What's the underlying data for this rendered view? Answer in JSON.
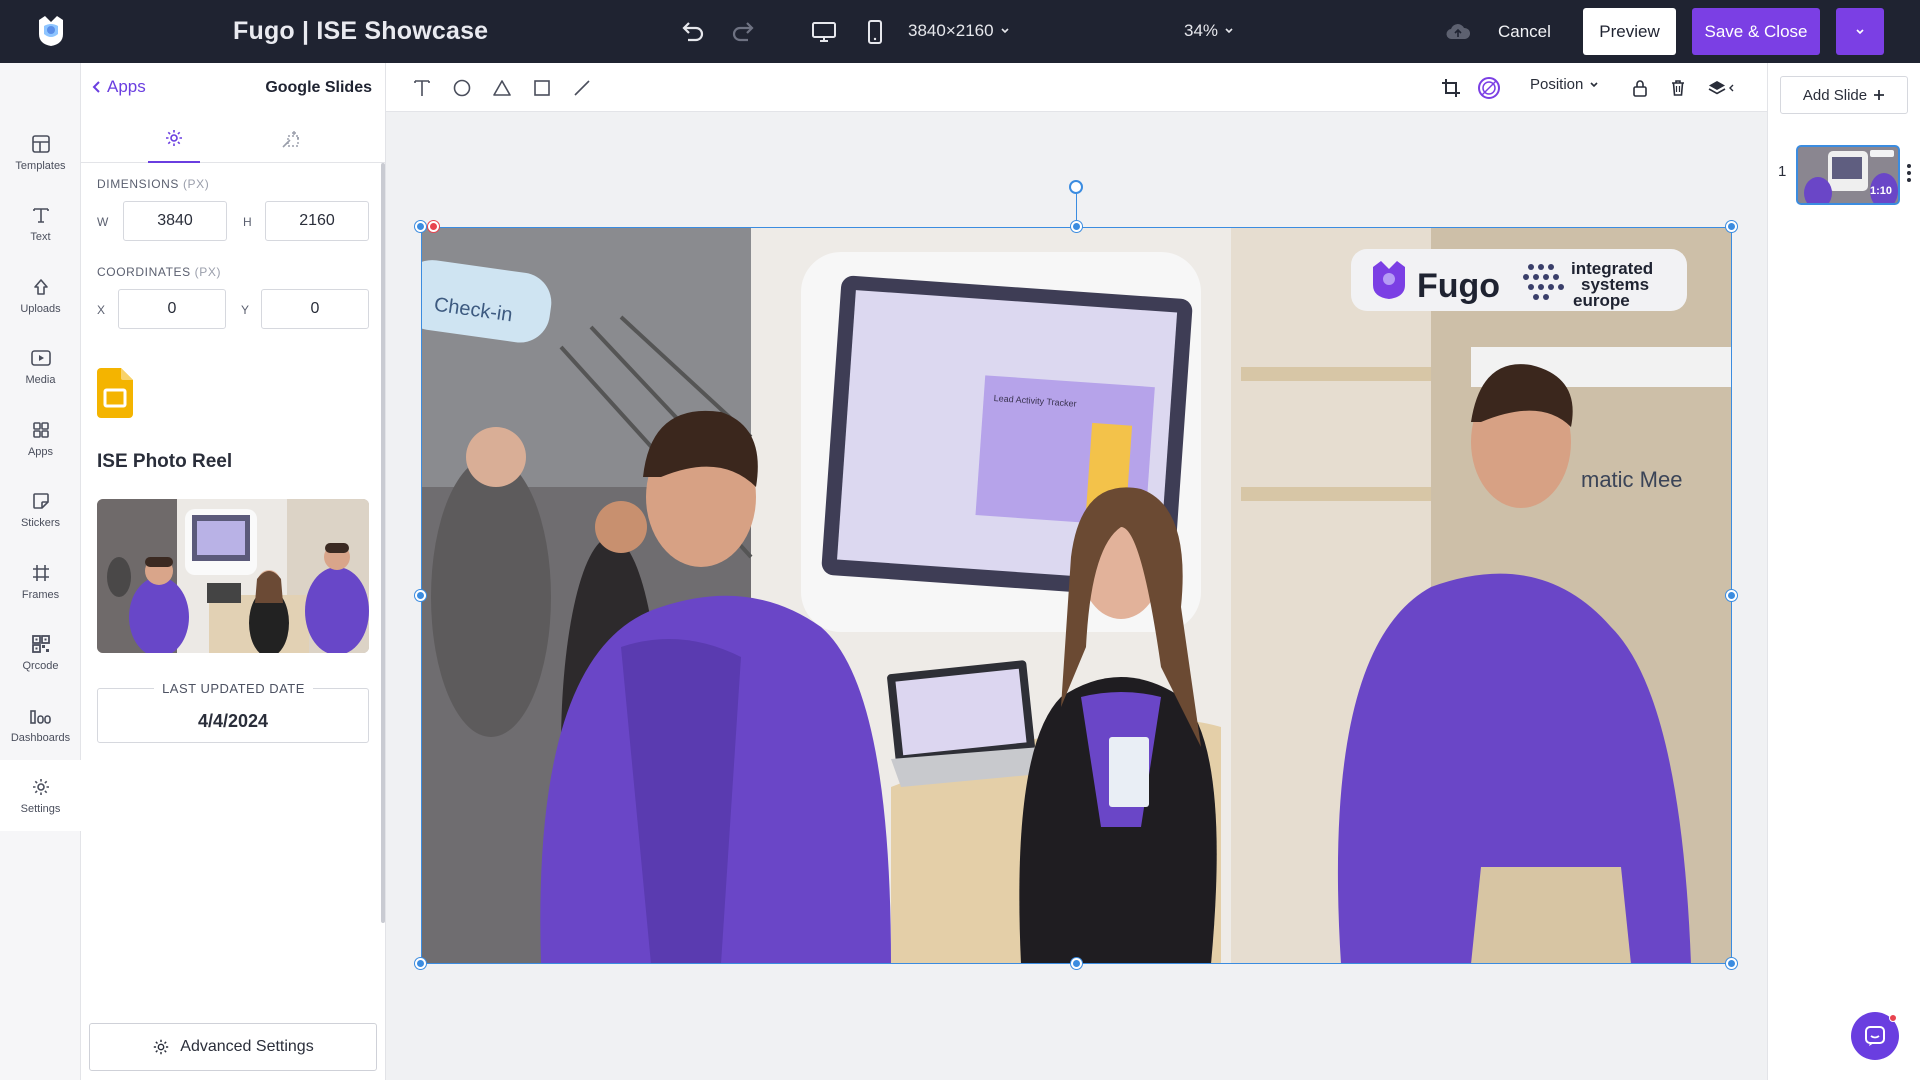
{
  "topbar": {
    "title": "Fugo | ISE Showcase",
    "resolution": "3840×2160",
    "zoom": "34%",
    "cancel_label": "Cancel",
    "preview_label": "Preview",
    "save_label": "Save & Close"
  },
  "rail": {
    "items": [
      {
        "label": "Templates",
        "icon": "templates-icon"
      },
      {
        "label": "Text",
        "icon": "text-icon"
      },
      {
        "label": "Uploads",
        "icon": "upload-icon"
      },
      {
        "label": "Media",
        "icon": "media-icon"
      },
      {
        "label": "Apps",
        "icon": "apps-icon"
      },
      {
        "label": "Stickers",
        "icon": "sticker-icon"
      },
      {
        "label": "Frames",
        "icon": "frames-icon"
      },
      {
        "label": "Qrcode",
        "icon": "qrcode-icon"
      },
      {
        "label": "Dashboards",
        "icon": "dashboards-icon"
      },
      {
        "label": "Settings",
        "icon": "gear-icon"
      }
    ]
  },
  "panel": {
    "back_label": "Apps",
    "title": "Google Slides",
    "dimensions_label": "DIMENSIONS",
    "coordinates_label": "COORDINATES",
    "unit_label": "(PX)",
    "w_label": "W",
    "h_label": "H",
    "x_label": "X",
    "y_label": "Y",
    "w_value": "3840",
    "h_value": "2160",
    "x_value": "0",
    "y_value": "0",
    "app_name": "ISE Photo Reel",
    "last_updated_label": "LAST UPDATED DATE",
    "last_updated_value": "4/4/2024",
    "advanced_label": "Advanced Settings"
  },
  "edtool": {
    "position_label": "Position"
  },
  "canvas": {
    "sign_left": "Check-in",
    "brand": "Fugo",
    "partner_line1": "integrated",
    "partner_line2": "systems",
    "partner_line3": "europe",
    "screen_text": "Lead Activity Tracker",
    "wall_text": "matic Mee"
  },
  "rside": {
    "add_slide_label": "Add Slide",
    "slide_number": "1",
    "slide_duration": "1:10"
  },
  "colors": {
    "topbar_bg": "#1f2331",
    "accent": "#7b3fe4",
    "selection": "#3b8ce0"
  }
}
